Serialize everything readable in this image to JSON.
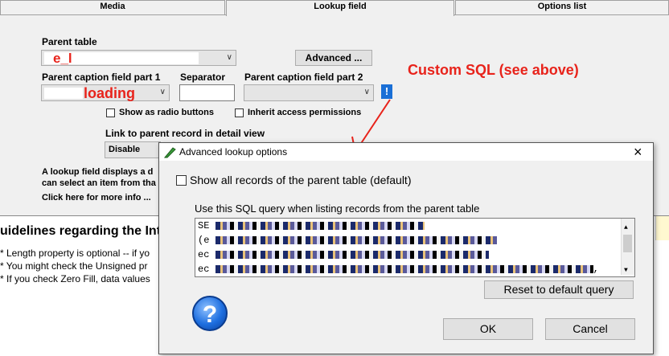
{
  "tabs": [
    {
      "label": "Media"
    },
    {
      "label": "Lookup field"
    },
    {
      "label": "Options list"
    }
  ],
  "form": {
    "parent_table_label": "Parent table",
    "parent_table_value": "e_l",
    "advanced_button": "Advanced ...",
    "caption_part1_label": "Parent caption field part 1",
    "caption_part1_value": "loading",
    "separator_label": "Separator",
    "caption_part2_label": "Parent caption field part 2",
    "show_as_radio_label": "Show as radio buttons",
    "inherit_access_label": "Inherit access permissions",
    "link_parent_label": "Link to parent record in detail view",
    "link_parent_value": "Disable",
    "info_line1": "A lookup field displays a d",
    "info_line2": "can select an item from tha",
    "info_link": "Click here for more info ...",
    "info_icon": "!"
  },
  "annotation": {
    "custom_sql": "Custom SQL (see above)"
  },
  "guidelines": {
    "title": "uidelines regarding the Int",
    "items": [
      "* Length property is optional -- if yo",
      "* You might check the Unsigned pr",
      "* If you check Zero Fill, data values"
    ]
  },
  "dialog": {
    "title": "Advanced lookup options",
    "close": "×",
    "show_all_label": "Show all records of the parent table (default)",
    "sql_label": "Use this SQL query when listing records from the parent table",
    "sql_lines": [
      "SE",
      "(e",
      "ec",
      "ec"
    ],
    "sql_line4_end": ",",
    "reset_button": "Reset to default query",
    "help_icon": "?",
    "ok_button": "OK",
    "cancel_button": "Cancel"
  },
  "colors": {
    "annotation_red": "#e8231b",
    "info_blue": "#1a6fd6"
  }
}
